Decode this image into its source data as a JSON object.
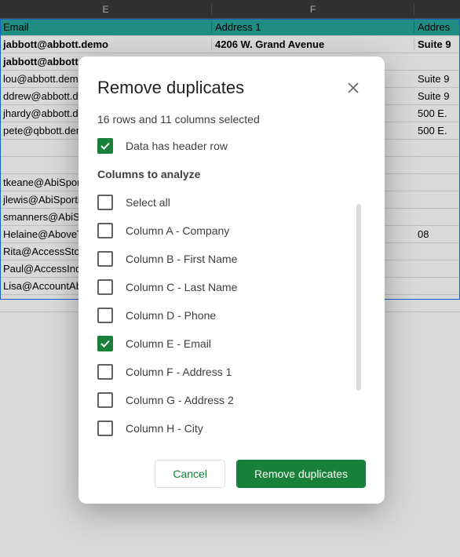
{
  "columns": {
    "E": "E",
    "F": "F",
    "G": ""
  },
  "header_row": {
    "e": "Email",
    "f": "Address 1",
    "g": "Addres"
  },
  "rows": [
    {
      "e": "jabbott@abbott.demo",
      "f": "4206 W. Grand Avenue",
      "g": "Suite 9",
      "bold": true
    },
    {
      "e": "jabbott@abbott.demo",
      "f": "",
      "g": "",
      "bold": true
    },
    {
      "e": "lou@abbott.demo",
      "f": "",
      "g": "Suite 9"
    },
    {
      "e": "ddrew@abbott.demo",
      "f": "",
      "g": "Suite 9"
    },
    {
      "e": "jhardy@abbott.demo",
      "f": "",
      "g": "500 E."
    },
    {
      "e": "pete@qbbott.demo",
      "f": "",
      "g": "500 E."
    },
    {
      "e": "",
      "f": "",
      "g": ""
    },
    {
      "e": "",
      "f": "",
      "g": ""
    },
    {
      "e": "tkeane@AbiSportinq.demo",
      "f": "",
      "g": ""
    },
    {
      "e": "jlewis@AbiSportinq.demo",
      "f": "",
      "g": ""
    },
    {
      "e": "smanners@AbiSportinq.demo",
      "f": "",
      "g": ""
    },
    {
      "e": "Helaine@AboveTheRest.demo",
      "f": "",
      "g": "08"
    },
    {
      "e": "Rita@AccessStours.demo",
      "f": "",
      "g": ""
    },
    {
      "e": "Paul@AccessIndustries.demo",
      "f": "",
      "g": ""
    },
    {
      "e": "Lisa@AccountAbility.demo",
      "f": "",
      "g": ""
    },
    {
      "e": "",
      "f": "",
      "g": ""
    }
  ],
  "dialog": {
    "title": "Remove duplicates",
    "info": "16 rows and 11 columns selected",
    "header_checkbox_label": "Data has header row",
    "header_checkbox_checked": true,
    "section_label": "Columns to analyze",
    "select_all_label": "Select all",
    "columns": [
      {
        "label": "Column A - Company",
        "checked": false
      },
      {
        "label": "Column B - First Name",
        "checked": false
      },
      {
        "label": "Column C - Last Name",
        "checked": false
      },
      {
        "label": "Column D - Phone",
        "checked": false
      },
      {
        "label": "Column E - Email",
        "checked": true
      },
      {
        "label": "Column F - Address 1",
        "checked": false
      },
      {
        "label": "Column G - Address 2",
        "checked": false
      },
      {
        "label": "Column H - City",
        "checked": false
      }
    ],
    "cancel": "Cancel",
    "confirm": "Remove duplicates"
  }
}
